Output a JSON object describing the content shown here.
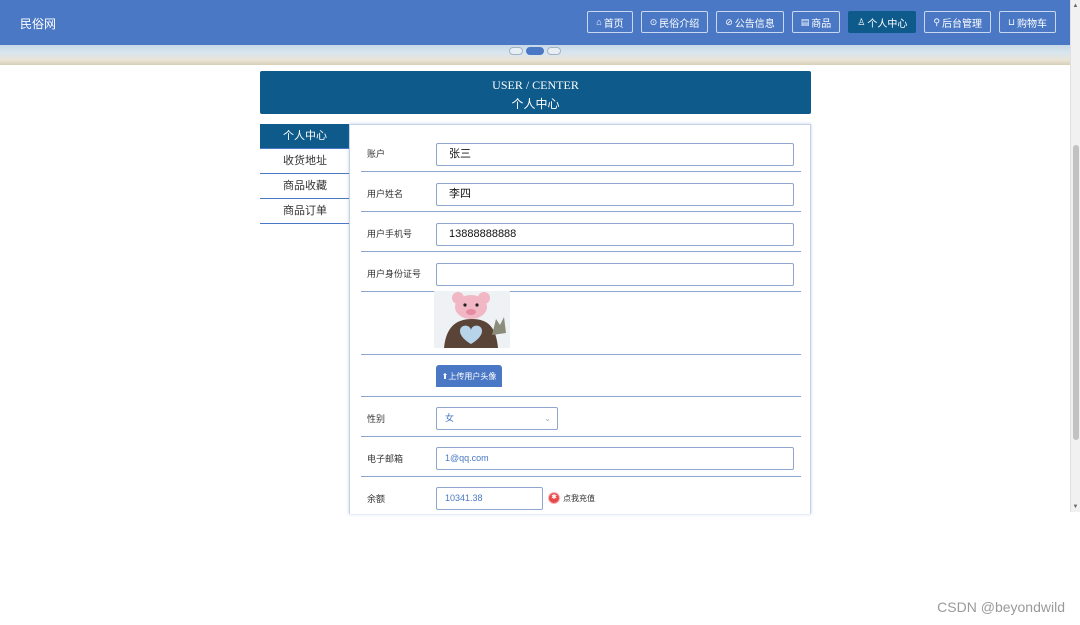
{
  "header": {
    "logo": "民俗网",
    "nav": [
      {
        "icon": "⌂",
        "label": "首页",
        "active": false
      },
      {
        "icon": "⊙",
        "label": "民俗介绍",
        "active": false
      },
      {
        "icon": "⊘",
        "label": "公告信息",
        "active": false
      },
      {
        "icon": "▤",
        "label": "商品",
        "active": false
      },
      {
        "icon": "♙",
        "label": "个人中心",
        "active": true
      },
      {
        "icon": "⚲",
        "label": "后台管理",
        "active": false
      },
      {
        "icon": "⊔",
        "label": "购物车",
        "active": false
      }
    ]
  },
  "section": {
    "title_en": "USER / CENTER",
    "title_cn": "个人中心"
  },
  "sidebar": {
    "items": [
      {
        "label": "个人中心",
        "active": true
      },
      {
        "label": "收货地址",
        "active": false
      },
      {
        "label": "商品收藏",
        "active": false
      },
      {
        "label": "商品订单",
        "active": false
      }
    ]
  },
  "form": {
    "account": {
      "label": "账户",
      "value": "张三"
    },
    "user_name": {
      "label": "用户姓名",
      "value": "李四"
    },
    "phone": {
      "label": "用户手机号",
      "value": "13888888888"
    },
    "id_card": {
      "label": "用户身份证号",
      "value": ""
    },
    "upload_button": "上传用户头像",
    "gender": {
      "label": "性别",
      "value": "女"
    },
    "email": {
      "label": "电子邮箱",
      "value": "1@qq.com"
    },
    "balance": {
      "label": "余额",
      "value": "10341.38",
      "recharge_label": "点我充值"
    }
  },
  "watermark": "CSDN @beyondwild",
  "colors": {
    "primary": "#4a78c5",
    "dark": "#0e5a8a"
  }
}
